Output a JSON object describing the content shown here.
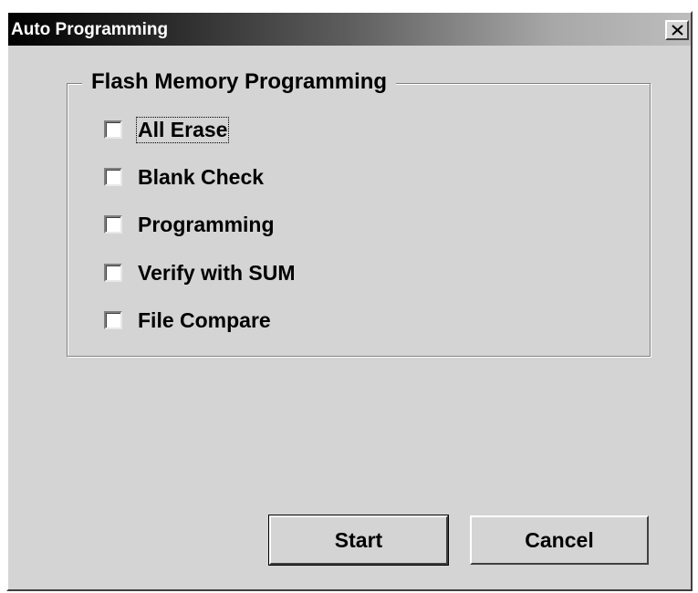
{
  "window": {
    "title": "Auto Programming",
    "close_icon": "close-x-icon"
  },
  "group": {
    "label": "Flash Memory Programming",
    "options": [
      {
        "label": "All Erase",
        "checked": false,
        "focused": true
      },
      {
        "label": "Blank Check",
        "checked": false,
        "focused": false
      },
      {
        "label": "Programming",
        "checked": false,
        "focused": false
      },
      {
        "label": "Verify with SUM",
        "checked": false,
        "focused": false
      },
      {
        "label": "File Compare",
        "checked": false,
        "focused": false
      }
    ]
  },
  "buttons": {
    "start_label": "Start",
    "cancel_label": "Cancel"
  }
}
